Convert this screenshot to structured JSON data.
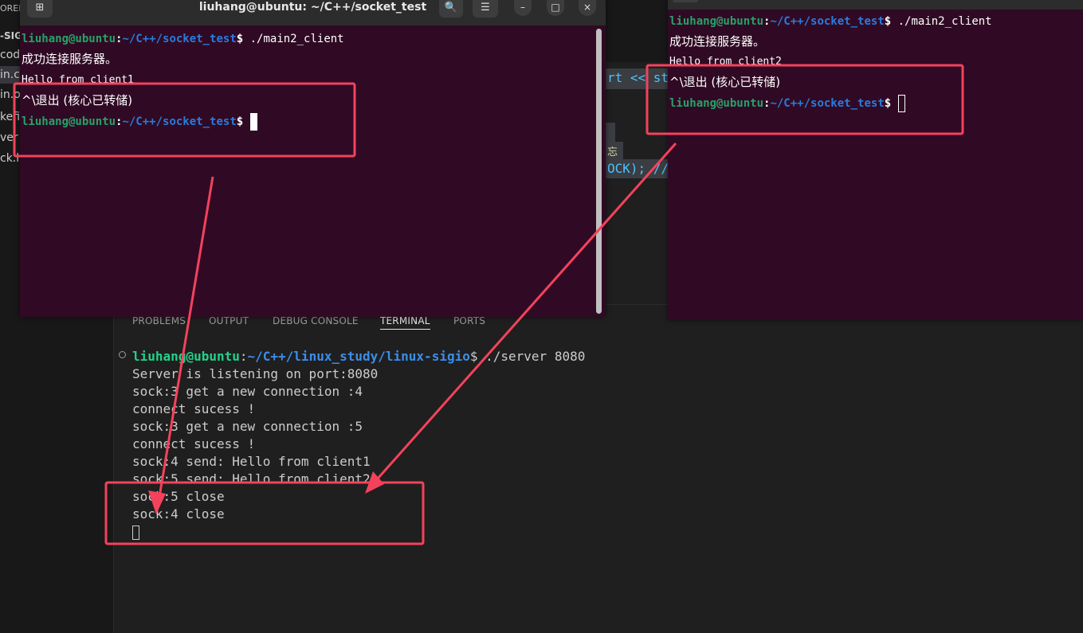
{
  "vscode": {
    "explorer": {
      "header": "ORER",
      "project": "-SIG",
      "items": [
        {
          "label": "code",
          "active": false
        },
        {
          "label": "in.c",
          "active": true
        },
        {
          "label": "in.o",
          "active": false
        },
        {
          "label": "kefi",
          "active": false
        },
        {
          "label": "ver",
          "active": false
        },
        {
          "label": "ck.h",
          "active": false
        }
      ]
    },
    "editor_fragments": {
      "line_a": "rt << st",
      "line_b": "忘",
      "line_c": "OCK); //"
    },
    "panel_tabs": [
      {
        "label": "PROBLEMS",
        "active": false
      },
      {
        "label": "OUTPUT",
        "active": false
      },
      {
        "label": "DEBUG CONSOLE",
        "active": false
      },
      {
        "label": "TERMINAL",
        "active": true
      },
      {
        "label": "PORTS",
        "active": false
      }
    ],
    "terminal": {
      "prompt_user": "liuhang@ubuntu",
      "prompt_path": "~/C++/linux_study/linux-sigio",
      "command": "./server 8080",
      "output": [
        "Server is listening on port:8080",
        "sock:3 get a new connection :4",
        "connect sucess !",
        "sock:3 get a new connection :5",
        "connect sucess !",
        "sock:4 send: Hello from client1",
        "sock:5 send: Hello from client2",
        "sock:5 close",
        "sock:4 close"
      ]
    }
  },
  "terminal1": {
    "title": "liuhang@ubuntu: ~/C++/socket_test",
    "buttons": {
      "new_tab": "⊞",
      "search": "🔍",
      "menu": "☰",
      "minimize": "–",
      "maximize": "□",
      "close": "×"
    },
    "prompt_user": "liuhang@ubuntu",
    "prompt_path": "~/C++/socket_test",
    "command": "./main2_client",
    "connected_msg": "成功连接服务器。",
    "hello": "Hello from client1",
    "quit_msg": "^\\退出 (核心已转储)"
  },
  "terminal2": {
    "prompt_user": "liuhang@ubuntu",
    "prompt_path": "~/C++/socket_test",
    "command": "./main2_client",
    "connected_msg": "成功连接服务器。",
    "hello": "Hello from client2",
    "quit_msg": "^\\退出 (核心已转储)"
  },
  "annotation_color": "#f4425c"
}
